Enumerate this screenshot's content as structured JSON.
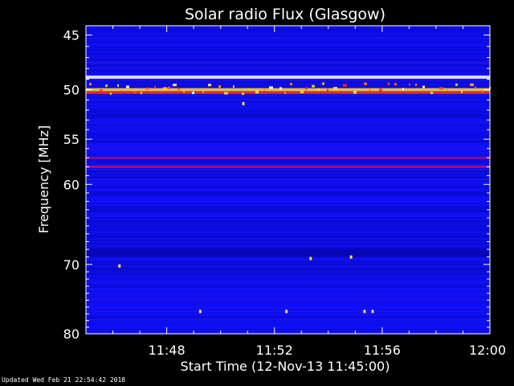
{
  "chart_data": {
    "type": "heatmap",
    "title": "Solar radio Flux (Glasgow)",
    "xlabel": "Start Time (12-Nov-13 11:45:00)",
    "ylabel": "Frequency [MHz]",
    "x_ticks": [
      "11:48",
      "11:52",
      "11:56",
      "12:00"
    ],
    "x_tick_minutes": [
      48,
      52,
      56,
      60
    ],
    "x_range_minutes": [
      45,
      60
    ],
    "y_ticks": [
      45,
      50,
      55,
      60,
      70,
      80
    ],
    "y_range": [
      44.2,
      80
    ],
    "y_scale": "log",
    "colormap": [
      "#000080",
      "#1010ff",
      "#c01060",
      "#ff3000",
      "#ffd000",
      "#ffffff"
    ],
    "features": [
      {
        "name": "strong emission",
        "freq": 48.8,
        "intensity": 1.0
      },
      {
        "name": "intermittent emission",
        "freq": 50.0,
        "intensity": 0.85
      },
      {
        "name": "intermittent emission",
        "freq": 50.3,
        "intensity": 0.6
      },
      {
        "name": "moderate band",
        "freq": 57.0,
        "intensity": 0.35
      },
      {
        "name": "moderate band",
        "freq": 58.0,
        "intensity": 0.4
      },
      {
        "name": "dark band",
        "freq": 68.5,
        "intensity": 0.05
      }
    ]
  },
  "footer": "Updated Wed Feb 21 22:54:42 2018"
}
